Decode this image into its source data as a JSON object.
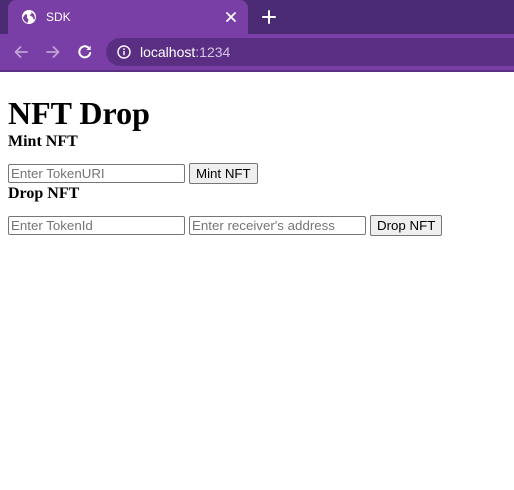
{
  "browser": {
    "tab_title": "SDK",
    "url_host": "localhost",
    "url_port": ":1234",
    "icons": {
      "favicon": "globe-icon",
      "tab_close": "close-icon",
      "new_tab": "plus-icon",
      "back": "arrow-left-icon",
      "forward": "arrow-right-icon",
      "reload": "reload-icon",
      "site_info": "info-icon"
    },
    "colors": {
      "tabstrip": "#4a2a73",
      "toolbar": "#7a3fa6",
      "omnibox": "#5a2f83"
    }
  },
  "page": {
    "title": "NFT Drop",
    "mint": {
      "heading": "Mint NFT",
      "token_uri_placeholder": "Enter TokenURI",
      "button_label": "Mint NFT"
    },
    "drop": {
      "heading": "Drop NFT",
      "token_id_placeholder": "Enter TokenId",
      "receiver_placeholder": "Enter receiver's address",
      "button_label": "Drop NFT"
    }
  }
}
